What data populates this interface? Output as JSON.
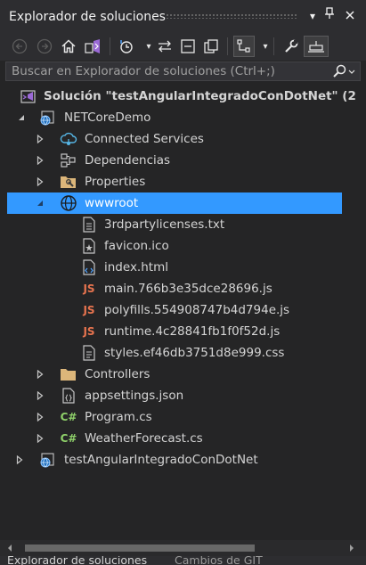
{
  "window": {
    "title": "Explorador de soluciones"
  },
  "search": {
    "placeholder": "Buscar en Explorador de soluciones (Ctrl+;)"
  },
  "tree": {
    "solution": "Solución \"testAngularIntegradoConDotNet\" (2",
    "project": "NETCoreDemo",
    "connected_services": "Connected Services",
    "dependencies": "Dependencias",
    "properties": "Properties",
    "wwwroot": "wwwroot",
    "files": {
      "licenses": "3rdpartylicenses.txt",
      "favicon": "favicon.ico",
      "index": "index.html",
      "main": "main.766b3e35dce28696.js",
      "polyfills": "polyfills.554908747b4d794e.js",
      "runtime": "runtime.4c28841fb1f0f52d.js",
      "styles": "styles.ef46db3751d8e999.css"
    },
    "controllers": "Controllers",
    "appsettings": "appsettings.json",
    "program": "Program.cs",
    "weather": "WeatherForecast.cs",
    "project2": "testAngularIntegradoConDotNet",
    "js_glyph": "JS",
    "cs_glyph": "C#"
  },
  "bottom_tabs": {
    "active": "Explorador de soluciones",
    "inactive": "Cambios de GIT"
  },
  "colors": {
    "background": "#252526",
    "selection": "#3399ff",
    "folder": "#dcb67a",
    "js": "#e8744f",
    "csharp": "#8fd16a"
  }
}
